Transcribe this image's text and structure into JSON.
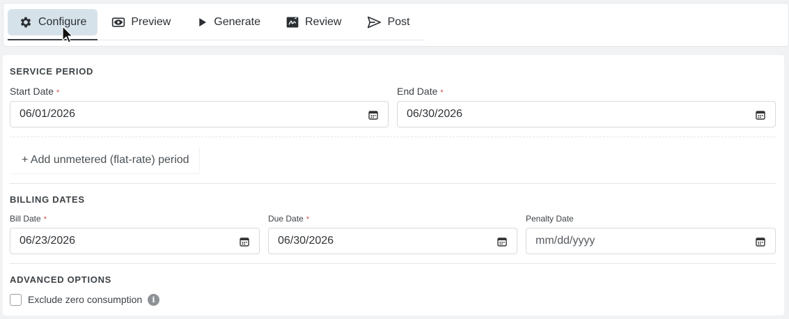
{
  "tabs": [
    {
      "label": "Configure",
      "icon": "gear-icon"
    },
    {
      "label": "Preview",
      "icon": "eye-icon"
    },
    {
      "label": "Generate",
      "icon": "play-icon"
    },
    {
      "label": "Review",
      "icon": "signature-icon"
    },
    {
      "label": "Post",
      "icon": "send-icon"
    }
  ],
  "active_tab": "Configure",
  "service_period": {
    "title": "SERVICE PERIOD",
    "start_label": "Start Date",
    "start_value": "06/01/2026",
    "end_label": "End Date",
    "end_value": "06/30/2026",
    "add_unmetered": "+ Add unmetered (flat-rate) period"
  },
  "billing_dates": {
    "title": "BILLING DATES",
    "bill_label": "Bill Date",
    "bill_value": "06/23/2026",
    "due_label": "Due Date",
    "due_value": "06/30/2026",
    "penalty_label": "Penalty Date",
    "penalty_value": "mm/dd/yyyy"
  },
  "advanced": {
    "title": "ADVANCED OPTIONS",
    "exclude_zero": "Exclude zero consumption",
    "exclude_zero_checked": false,
    "info_glyph": "i"
  },
  "required_mark": "*",
  "colors": {
    "active_tab_bg": "#d6e2ea",
    "required": "#d04a4a",
    "border": "#d7d9dc"
  }
}
